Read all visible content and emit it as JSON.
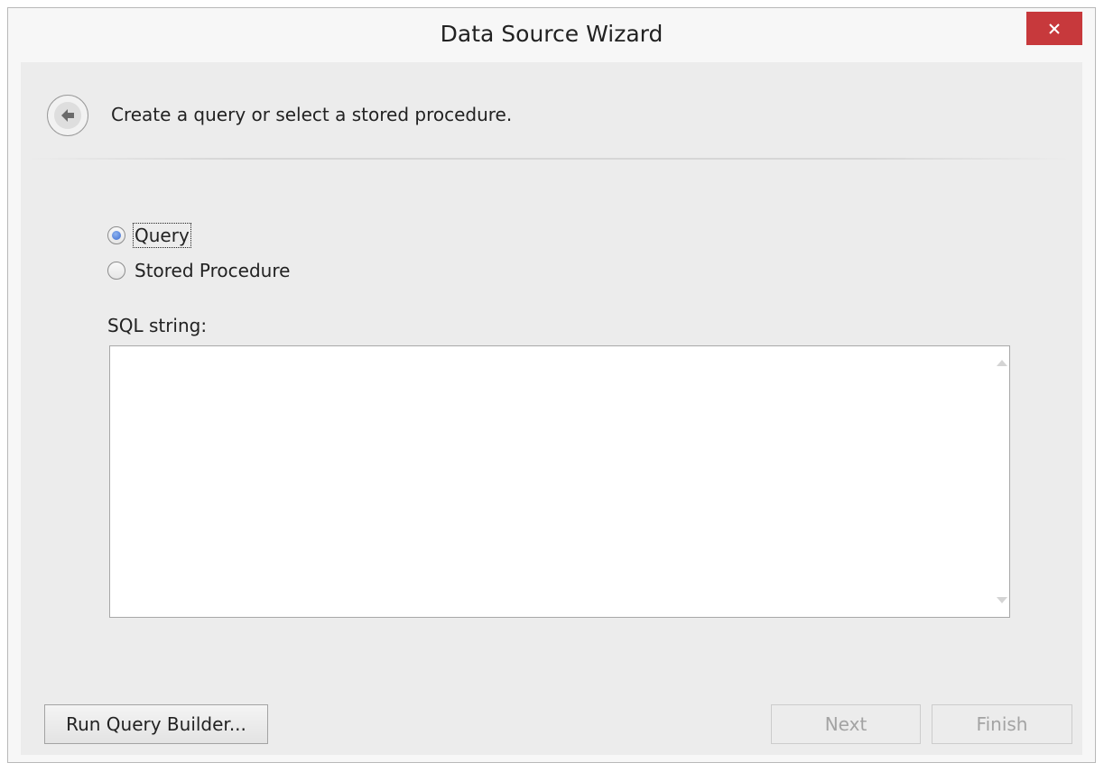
{
  "window": {
    "title": "Data Source Wizard"
  },
  "header": {
    "instruction": "Create a query or select a stored procedure."
  },
  "options": {
    "query_label": "Query",
    "query_checked": true,
    "stored_procedure_label": "Stored Procedure",
    "stored_procedure_checked": false
  },
  "sql": {
    "label": "SQL string:",
    "value": ""
  },
  "buttons": {
    "run_query_builder": "Run Query Builder...",
    "next": "Next",
    "finish": "Finish"
  },
  "icons": {
    "close": "close-icon",
    "back": "back-arrow-icon"
  },
  "colors": {
    "close_button": "#c7393c",
    "radio_selected": "#3b6bd1"
  }
}
